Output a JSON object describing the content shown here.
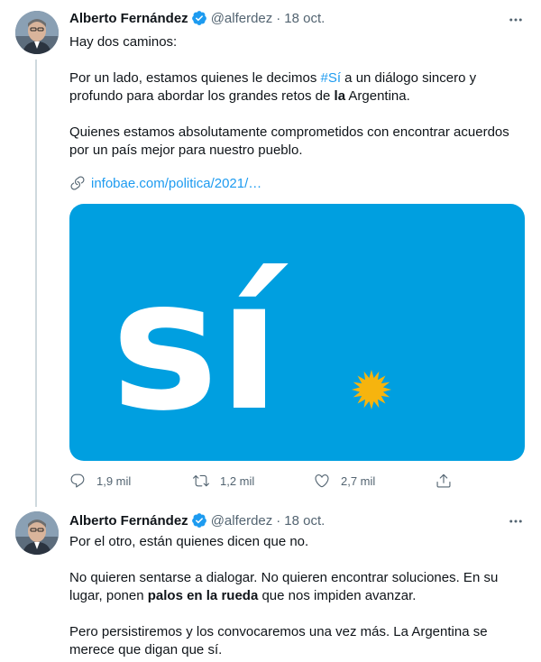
{
  "tweet1": {
    "author": "Alberto Fernández",
    "handle": "@alferdez",
    "separator": "·",
    "date": "18 oct.",
    "text_line1": "Hay dos caminos:",
    "p2_a": "Por un lado, estamos quienes le decimos ",
    "p2_hashtag": "#Sí",
    "p2_b": " a un diálogo sincero y profundo para abordar los grandes retos de ",
    "p2_bold": "la",
    "p2_c": " Argentina.",
    "p3": "Quienes estamos absolutamente comprometidos con encontrar acuerdos por un país mejor para nuestro pueblo.",
    "link_text": "infobae.com/politica/2021/…",
    "media_alt": "sí",
    "replies": "1,9 mil",
    "retweets": "1,2 mil",
    "likes": "2,7 mil"
  },
  "tweet2": {
    "author": "Alberto Fernández",
    "handle": "@alferdez",
    "separator": "·",
    "date": "18 oct.",
    "p1": "Por el otro, están quienes dicen que no.",
    "p2_a": "No quieren sentarse a dialogar. No quieren encontrar soluciones. En su lugar, ponen ",
    "p2_bold": "palos en la rueda",
    "p2_b": " que nos impiden avanzar.",
    "p3": "Pero persistiremos y los convocaremos una vez más. La Argentina se merece que digan que sí."
  },
  "colors": {
    "accent": "#1d9bf0",
    "media_bg": "#009fe0",
    "sun": "#f6b40e",
    "muted": "#536471"
  }
}
